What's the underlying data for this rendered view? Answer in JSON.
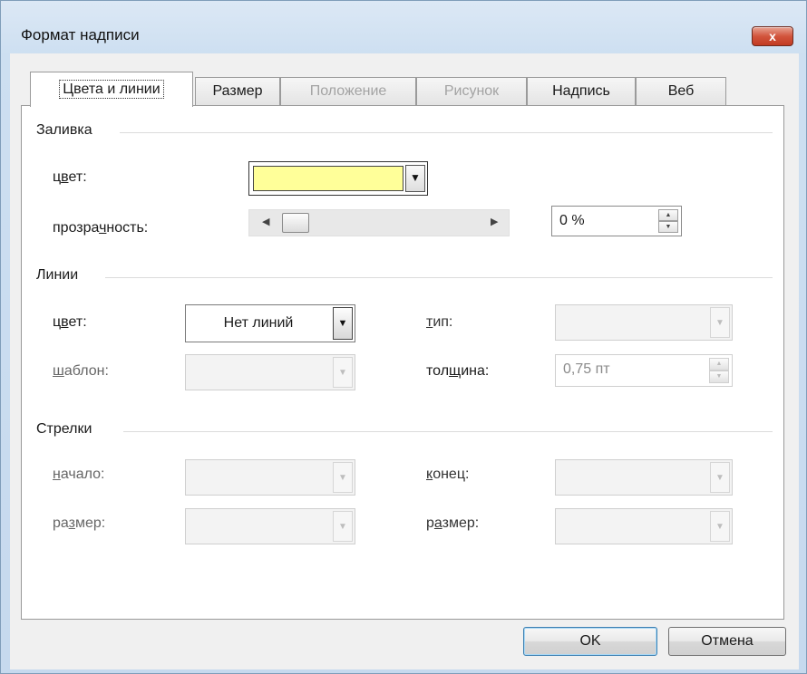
{
  "window": {
    "title": "Формат надписи",
    "close_label": "x"
  },
  "tabs": [
    {
      "label": "Цвета и линии",
      "state": "active"
    },
    {
      "label": "Размер",
      "state": "normal"
    },
    {
      "label": "Положение",
      "state": "disabled"
    },
    {
      "label": "Рисунок",
      "state": "disabled"
    },
    {
      "label": "Надпись",
      "state": "normal"
    },
    {
      "label": "Веб",
      "state": "normal"
    }
  ],
  "fill": {
    "section": "Заливка",
    "color_label_pre": "ц",
    "color_label_u": "в",
    "color_label_post": "ет:",
    "color_value": "#ffff99",
    "transparency_label_pre": "прозра",
    "transparency_label_u": "ч",
    "transparency_label_post": "ность:",
    "transparency_value": "0 %",
    "transparency_level": 0
  },
  "lines": {
    "section": "Линии",
    "color_label_pre": "ц",
    "color_label_u": "в",
    "color_label_post": "ет:",
    "color_value": "Нет линий",
    "type_label_u": "т",
    "type_label_post": "ип:",
    "pattern_label_u": "ш",
    "pattern_label_post": "аблон:",
    "weight_label_pre": "тол",
    "weight_label_u": "щ",
    "weight_label_post": "ина:",
    "weight_value": "0,75 пт"
  },
  "arrows": {
    "section": "Стрелки",
    "begin_label_u": "н",
    "begin_label_post": "ачало:",
    "end_label_u": "к",
    "end_label_post": "онец:",
    "begin_size_label_pre": "ра",
    "begin_size_label_u": "з",
    "begin_size_label_post": "мер:",
    "end_size_label_pre": "р",
    "end_size_label_u": "а",
    "end_size_label_post": "змер:"
  },
  "buttons": {
    "ok": "OK",
    "cancel": "Отмена"
  },
  "icons": {
    "close": "close-icon",
    "dropdown": "chevron-down-icon",
    "spin_up": "spin-up-icon",
    "spin_down": "spin-down-icon",
    "slider_left": "arrow-left-icon",
    "slider_right": "arrow-right-icon"
  }
}
